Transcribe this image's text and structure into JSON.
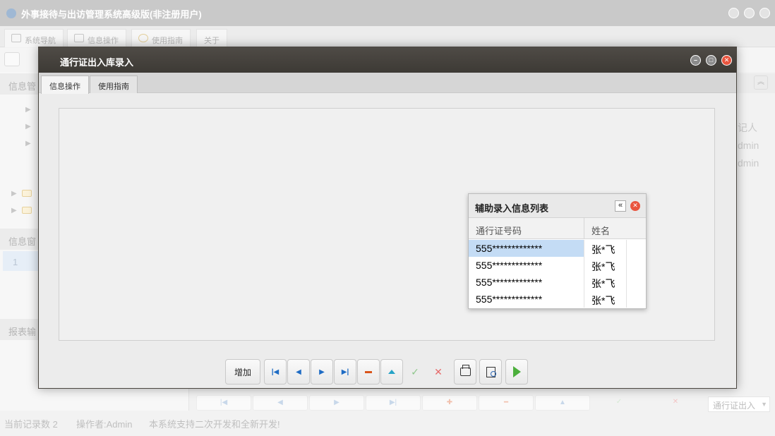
{
  "app": {
    "title": "外事接待与出访管理系统高级版(非注册用户)",
    "tabs": [
      "系统导航",
      "信息操作",
      "使用指南",
      "关于"
    ],
    "left_panel": {
      "header1": "信息管",
      "header2": "信息窗",
      "header3": "报表输",
      "row_number": "1"
    },
    "right_cells": [
      "记人",
      "dmin",
      "dmin"
    ],
    "combo_value": "通行证出入",
    "status": {
      "record_count": "当前记录数 2",
      "operator": "操作者:Admin",
      "message": "本系统支持二次开发和全新开发!"
    }
  },
  "dialog": {
    "title": "通行证出入库录入",
    "tabs": [
      {
        "label": "信息操作",
        "active": true
      },
      {
        "label": "使用指南",
        "active": false
      }
    ],
    "toolbar": {
      "add_label": "增加"
    }
  },
  "helper": {
    "title": "辅助录入信息列表",
    "columns": [
      "通行证号码",
      "姓名"
    ],
    "rows": [
      {
        "passport": "555*************",
        "name": "张*飞",
        "selected": true
      },
      {
        "passport": "555*************",
        "name": "张*飞",
        "selected": false
      },
      {
        "passport": "555*************",
        "name": "张*飞",
        "selected": false
      },
      {
        "passport": "555*************",
        "name": "张*飞",
        "selected": false
      }
    ]
  }
}
